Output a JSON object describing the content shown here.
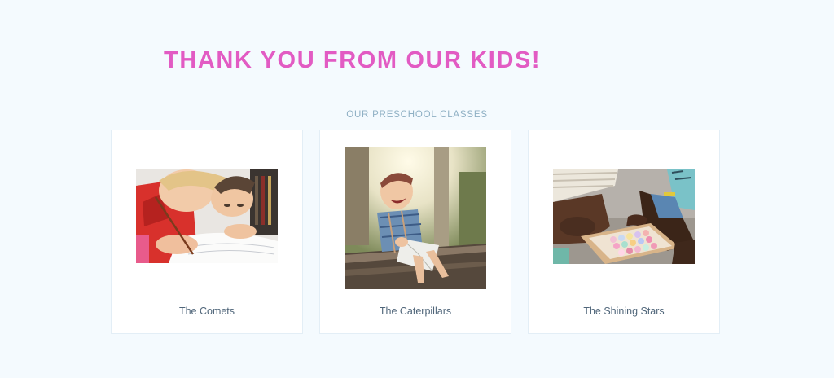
{
  "hero": {
    "title": "THANK YOU FROM OUR KIDS!"
  },
  "section": {
    "label": "OUR PRESCHOOL CLASSES"
  },
  "classes": [
    {
      "name": "The Comets",
      "photo_description": "two-children-drawing-photo"
    },
    {
      "name": "The Caterpillars",
      "photo_description": "laughing-boy-reading-photo"
    },
    {
      "name": "The Shining Stars",
      "photo_description": "children-with-chalk-photo"
    }
  ],
  "colors": {
    "background": "#f4fafe",
    "title": "#e25bc3",
    "section_label": "#8fb0c4",
    "caption": "#50667a",
    "card_border": "#e3eef6"
  }
}
